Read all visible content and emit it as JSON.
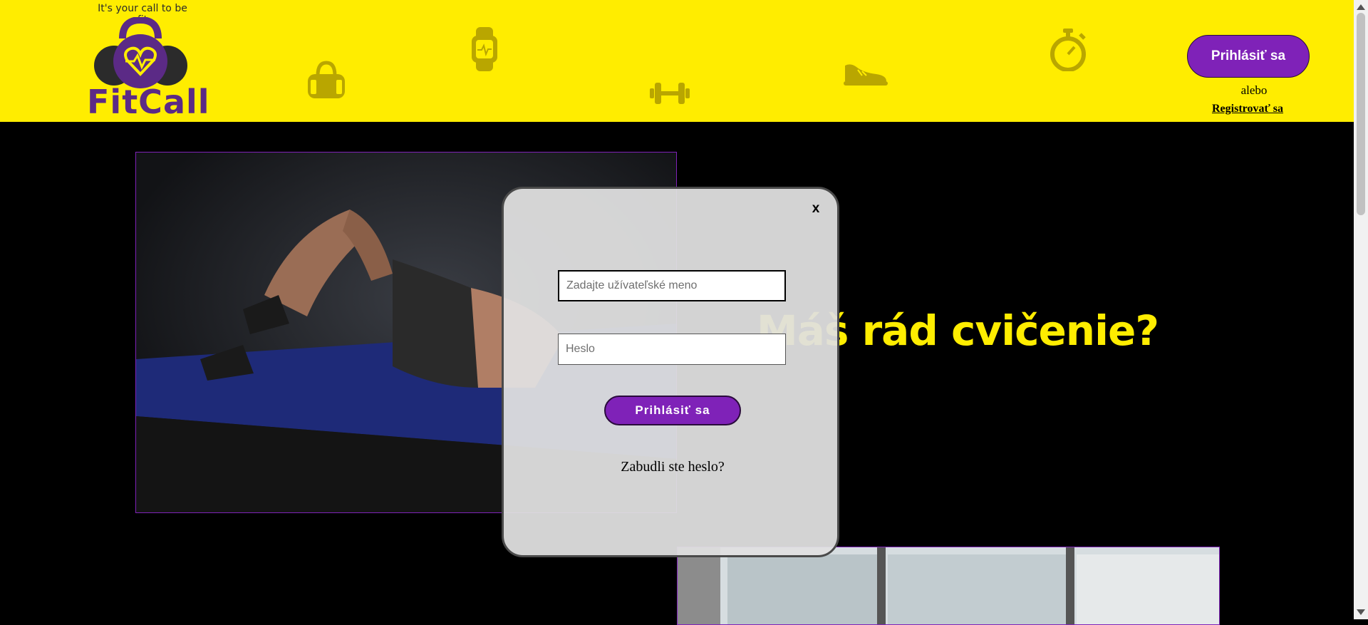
{
  "header": {
    "tagline": "It's your call to be fit",
    "brand": "FitCall",
    "login_label": "Prihlásiť sa",
    "or_label": "alebo",
    "register_label": "Registrovať sa"
  },
  "main": {
    "headline": "Máš rád cvičenie?"
  },
  "login_modal": {
    "close_label": "x",
    "username_placeholder": "Zadajte užívateľské meno",
    "username_value": "",
    "password_placeholder": "Heslo",
    "password_value": "",
    "submit_label": "Prihlásiť sa",
    "forgot_label": "Zabudli ste heslo?"
  },
  "decorative_icons": [
    "gym-bag-icon",
    "smartwatch-icon",
    "dumbbell-icon",
    "sneaker-icon",
    "stopwatch-icon"
  ],
  "colors": {
    "header_bg": "#ffed00",
    "brand_purple": "#5b2a86",
    "button_purple": "#7f22b8",
    "page_bg": "#000000",
    "modal_bg": "#e0e0e0",
    "headline": "#ffed00"
  }
}
